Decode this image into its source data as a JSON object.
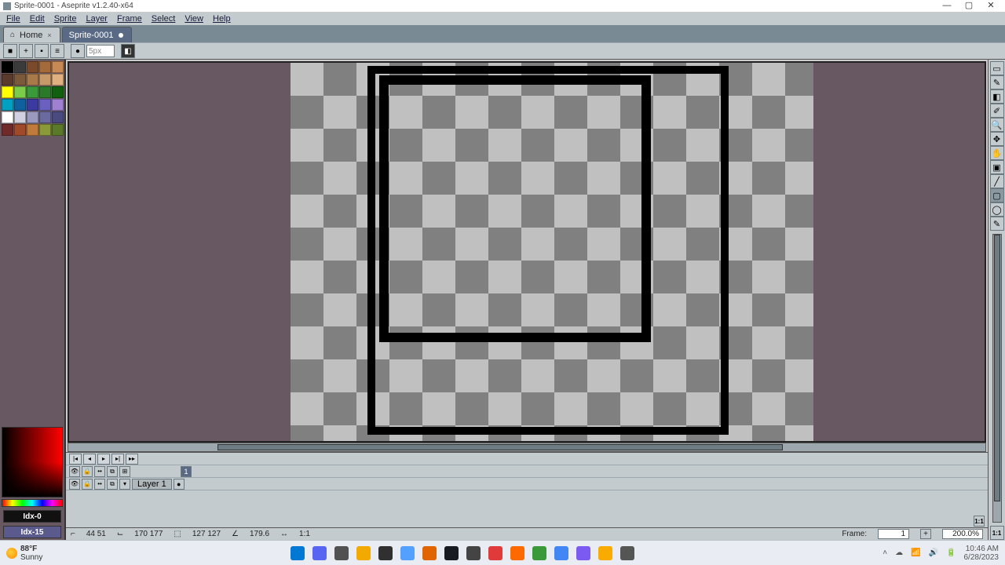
{
  "window": {
    "title": "Sprite-0001 - Aseprite v1.2.40-x64"
  },
  "menu": {
    "items": [
      "File",
      "Edit",
      "Sprite",
      "Layer",
      "Frame",
      "Select",
      "View",
      "Help"
    ]
  },
  "tabs": {
    "home": {
      "label": "Home"
    },
    "doc": {
      "label": "Sprite-0001"
    }
  },
  "toolbar": {
    "brush_size": "5px"
  },
  "palette": {
    "colors": [
      "#000000",
      "#3b3b3b",
      "#7a4a2a",
      "#a56a3a",
      "#c88a54",
      "#5a3a2a",
      "#7a5a3a",
      "#a87a4a",
      "#c89a6a",
      "#e0b080",
      "#ffff00",
      "#7acc4a",
      "#3a9a3a",
      "#2a7a2a",
      "#106010",
      "#00a0c0",
      "#1060a0",
      "#3a3aa0",
      "#6a60c0",
      "#a080d0",
      "#ffffff",
      "#d0d0e0",
      "#9a9ac0",
      "#6a6aa0",
      "#4a4a80",
      "#702a2a",
      "#a04a2a",
      "#c07a3a",
      "#8a9a3a",
      "#5a7a2a"
    ],
    "idx_fg": "Idx-0",
    "idx_bg": "Idx-15"
  },
  "tools": [
    {
      "name": "marquee-icon",
      "glyph": "▭"
    },
    {
      "name": "pencil-icon",
      "glyph": "✎"
    },
    {
      "name": "eraser-icon",
      "glyph": "◧"
    },
    {
      "name": "eyedropper-icon",
      "glyph": "✐"
    },
    {
      "name": "zoom-icon",
      "glyph": "🔍"
    },
    {
      "name": "move-icon",
      "glyph": "✥"
    },
    {
      "name": "hand-icon",
      "glyph": "✋"
    },
    {
      "name": "paint-bucket-icon",
      "glyph": "▣"
    },
    {
      "name": "line-icon",
      "glyph": "╱"
    },
    {
      "name": "rectangle-icon",
      "glyph": "▢"
    },
    {
      "name": "ellipse-icon",
      "glyph": "◯"
    },
    {
      "name": "contour-icon",
      "glyph": "✎"
    }
  ],
  "timeline": {
    "frame_header": "1",
    "layers": [
      {
        "name": "Layer 1"
      }
    ]
  },
  "status": {
    "cursor_xy": "44 51",
    "canvas_xy": "170 177",
    "size": "127 127",
    "angle": "179.6",
    "ratio": "1:1",
    "frame_label": "Frame:",
    "frame_value": "1",
    "zoom": "200.0%"
  },
  "taskbar": {
    "temp": "88°F",
    "cond": "Sunny",
    "time": "10:46 AM",
    "date": "6/28/2023",
    "icon_colors": [
      "#0078d4",
      "#5865f2",
      "#515151",
      "#f2a900",
      "#303030",
      "#54a0ff",
      "#e06500",
      "#171a21",
      "#444444",
      "#e03a3a",
      "#ff6a00",
      "#3a9a3a",
      "#4285f4",
      "#7a5af0",
      "#f9ab00",
      "#555555"
    ]
  }
}
